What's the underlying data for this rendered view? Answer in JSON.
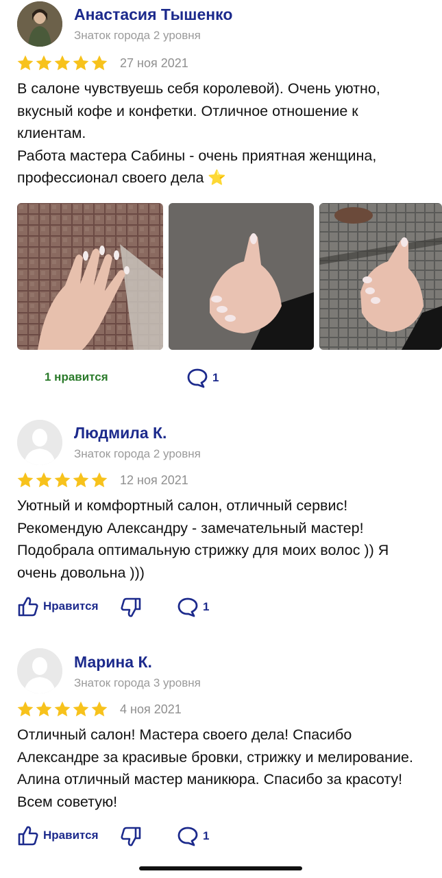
{
  "reviews": [
    {
      "author": "Анастасия Тышенко",
      "level": "Знаток города 2 уровня",
      "rating": 5,
      "date": "27 ноя 2021",
      "text_lines": [
        "В салоне чувствуешь себя королевой). Очень уютно, вкусный кофе и конфетки. Отличное отношение к клиентам.",
        "Работа мастера Сабины - очень приятная женщина, профессионал своего дела ⭐"
      ],
      "photos": [
        "manicure-photo-1",
        "manicure-photo-2",
        "manicure-photo-3"
      ],
      "likes_label": "1 нравится",
      "comments_count": "1"
    },
    {
      "author": "Людмила К.",
      "level": "Знаток города 2 уровня",
      "rating": 5,
      "date": "12 ноя 2021",
      "text_lines": [
        "Уютный и комфортный салон, отличный сервис! Рекомендую Александру - замечательный мастер! Подобрала оптимальную стрижку для моих волос )) Я очень довольна )))"
      ],
      "like_label": "Нравится",
      "comments_count": "1"
    },
    {
      "author": "Марина К.",
      "level": "Знаток города 3 уровня",
      "rating": 5,
      "date": "4 ноя 2021",
      "text_lines": [
        "Отличный салон! Мастера своего дела! Спасибо Александре за красивые бровки, стрижку и мелирование. Алина отличный мастер маникюра. Спасибо за красоту! Всем советую!"
      ],
      "like_label": "Нравится",
      "comments_count": "1"
    }
  ],
  "colors": {
    "accent": "#1c2a8c",
    "star": "#f7c21c",
    "liked": "#2a7a2a",
    "muted": "#9a9a9a"
  }
}
